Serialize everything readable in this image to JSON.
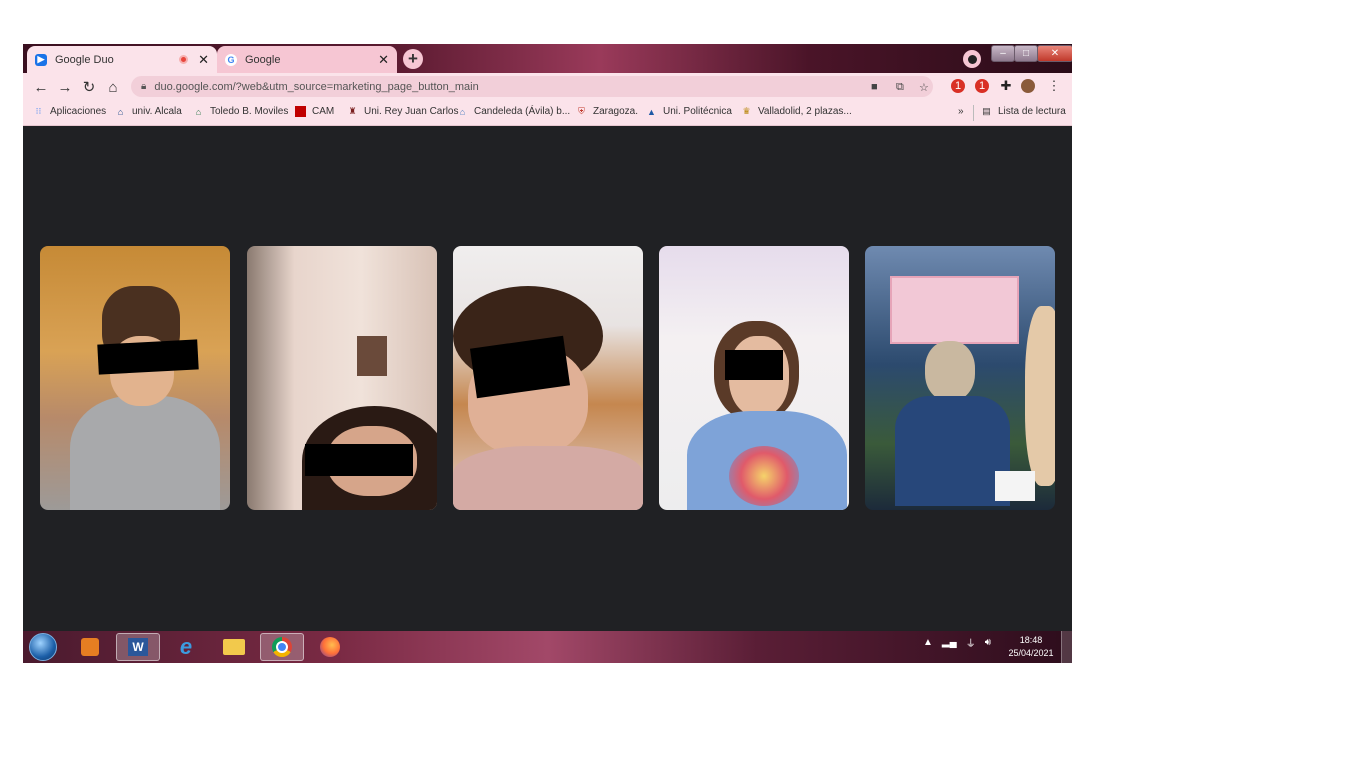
{
  "tabs": [
    {
      "title": "Google Duo",
      "favicon": "duo-icon",
      "active": true,
      "recording": true
    },
    {
      "title": "Google",
      "favicon": "google-g-icon",
      "active": false
    }
  ],
  "new_tab_symbol": "+",
  "window_controls": {
    "minimize": "–",
    "maximize": "□",
    "close": "✕"
  },
  "toolbar": {
    "back": "←",
    "forward": "→",
    "reload": "↻",
    "home": "⌂",
    "url": "duo.google.com/?web&utm_source=marketing_page_button_main"
  },
  "extensions": [
    {
      "name": "extension-red-1",
      "badge": "1",
      "color": "#d93025"
    },
    {
      "name": "extension-red-2",
      "badge": "1",
      "color": "#d93025"
    },
    {
      "name": "extensions-puzzle-icon",
      "color": "#222"
    },
    {
      "name": "avatar",
      "color": "#8a5a3a"
    }
  ],
  "bookmarks": [
    {
      "label": "Aplicaciones",
      "icon": "apps-grid-icon",
      "color": "#4285f4"
    },
    {
      "label": "univ. Alcala",
      "icon": "building-icon",
      "color": "#1f4e8c"
    },
    {
      "label": "Toledo B. Moviles",
      "icon": "building-icon",
      "color": "#2c7a4b"
    },
    {
      "label": "CAM",
      "icon": "flag-icon",
      "color": "#c00000"
    },
    {
      "label": "Uni. Rey Juan Carlos",
      "icon": "tower-icon",
      "color": "#7a1f1f"
    },
    {
      "label": "Candeleda (Ávila) b...",
      "icon": "building-icon",
      "color": "#4a7fc1"
    },
    {
      "label": "Zaragoza.",
      "icon": "shield-icon",
      "color": "#c0392b"
    },
    {
      "label": "Uni. Politécnica",
      "icon": "mountain-icon",
      "color": "#1f5aa6"
    },
    {
      "label": "Valladolid, 2 plazas...",
      "icon": "crest-icon",
      "color": "#b8860b"
    }
  ],
  "bookmarks_overflow": "»",
  "reading_list": "Lista de lectura",
  "participants": [
    {
      "name": "participant-1"
    },
    {
      "name": "participant-2"
    },
    {
      "name": "participant-3"
    },
    {
      "name": "participant-4"
    },
    {
      "name": "participant-5"
    }
  ],
  "taskbar": {
    "apps": [
      {
        "name": "media-player-icon",
        "active": false
      },
      {
        "name": "word-icon",
        "active": true
      },
      {
        "name": "internet-explorer-icon",
        "active": false
      },
      {
        "name": "file-explorer-icon",
        "active": false
      },
      {
        "name": "chrome-icon",
        "active": true
      },
      {
        "name": "firefox-icon",
        "active": false
      }
    ],
    "time": "18:48",
    "date": "25/04/2021"
  },
  "colors": {
    "tab_active": "#fbe3ea",
    "toolbar": "#fbe3ea",
    "omnibox": "#f2cfd9",
    "content_bg": "#202124"
  }
}
